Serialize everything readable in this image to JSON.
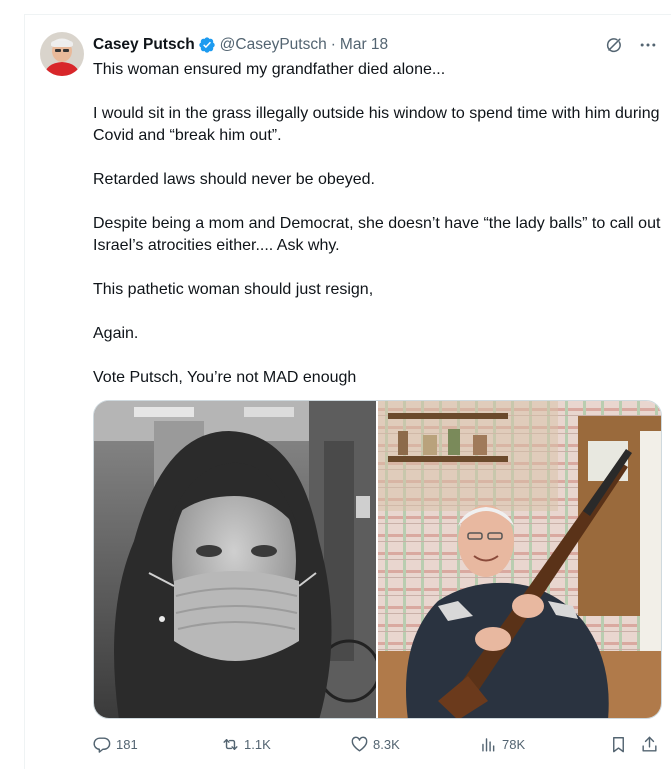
{
  "tweet": {
    "author_name": "Casey Putsch",
    "handle": "@CaseyPutsch",
    "separator": "·",
    "date": "Mar 18",
    "paragraphs": [
      "This woman ensured my grandfather died alone...",
      "I would sit in the grass illegally outside his window to spend time with him during Covid and “break him out”.",
      "Retarded laws should never be obeyed.",
      "Despite being a mom and Democrat, she doesn’t have “the lady balls” to call out Israel’s atrocities either.... Ask why.",
      "This pathetic woman should just resign,",
      "Again.",
      "Vote Putsch, You’re not MAD enough"
    ]
  },
  "media": [
    {
      "icon": "photo-masked-woman",
      "description_visible": false
    },
    {
      "icon": "photo-elderly-man-with-rifle",
      "description_visible": false
    }
  ],
  "actions": {
    "replies": "181",
    "reposts": "1.1K",
    "likes": "8.3K",
    "views": "78K"
  },
  "icons": {
    "verified": "verified-badge-icon",
    "grok": "grok-icon",
    "more": "more-icon",
    "reply": "reply-icon",
    "repost": "repost-icon",
    "like": "heart-icon",
    "views": "views-icon",
    "bookmark": "bookmark-icon",
    "share": "share-icon"
  },
  "colors": {
    "text": "#0f1419",
    "secondary": "#536471",
    "verified": "#1d9bf0",
    "border": "#cfd9de"
  }
}
